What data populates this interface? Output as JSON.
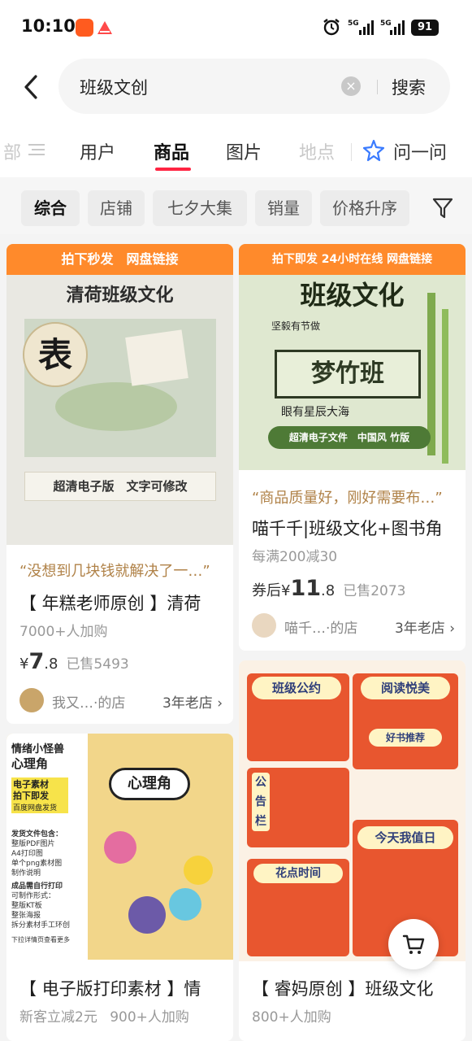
{
  "status_bar": {
    "time": "10:10",
    "signal1": "5G",
    "signal2": "5G",
    "battery": "91",
    "icons": [
      "app-icon",
      "app-icon",
      "alarm-icon",
      "signal-icon",
      "signal-icon",
      "battery-icon"
    ]
  },
  "search": {
    "query": "班级文创",
    "clear_icon": "close-icon",
    "submit_label": "搜索"
  },
  "tabs": [
    {
      "label": "部"
    },
    {
      "label": "用户"
    },
    {
      "label": "商品",
      "active": true
    },
    {
      "label": "图片"
    },
    {
      "label": "地点"
    },
    {
      "label": "问一问"
    }
  ],
  "filters": [
    {
      "label": "综合",
      "active": true
    },
    {
      "label": "店铺"
    },
    {
      "label": "七夕大集"
    },
    {
      "label": "销量"
    },
    {
      "label": "价格升序"
    }
  ],
  "products": [
    {
      "banner": "拍下秒发　网盘链接",
      "image_text_1": "清荷班级文化",
      "image_text_2": "表",
      "image_text_3": "超清电子版　文字可修改",
      "quote": "“没想到几块钱就解决了一…”",
      "title": "【 年糕老师原创 】清荷",
      "meta": "7000+人加购",
      "price_symbol": "¥",
      "price_int": "7",
      "price_dec": ".8",
      "sold": "已售5493",
      "shop_name": "我又…·的店",
      "shop_age": "3年老店"
    },
    {
      "banner": "拍下即发 24小时在线 网盘链接",
      "image_text_1": "班级文化",
      "image_text_2": "梦竹班",
      "image_text_3": "坚毅有节做",
      "image_text_4": "眼有星辰大海",
      "image_text_5": "超清电子文件　中国风 竹版",
      "quote": "“商品质量好，刚好需要布…”",
      "title": "喵千千|班级文化+图书角",
      "meta": "每满200减30",
      "price_prefix": "券后",
      "price_symbol": "¥",
      "price_int": "11",
      "price_dec": ".8",
      "sold": "已售2073",
      "shop_name": "喵千…·的店",
      "shop_age": "3年老店"
    },
    {
      "image_text_1": "情绪小怪兽",
      "image_text_2": "心理角",
      "image_text_3": "电子素材",
      "image_text_4": "拍下即发",
      "image_text_5": "百度网盘发货",
      "image_text_6": "发货文件包含：",
      "image_text_7": "整版PDF图片",
      "image_text_8": "A4打印图",
      "image_text_9": "单个png素材图",
      "image_text_10": "制作说明",
      "image_text_11": "成品需自行打印",
      "image_text_12": "可制作形式：",
      "image_text_13": "整版KT板",
      "image_text_14": "整张海报",
      "image_text_15": "拆分素材手工环创",
      "image_text_16": "下拉详情页查看更多",
      "image_text_17": "心理角",
      "title": "【 电子版打印素材 】情",
      "meta_a": "新客立减2元",
      "meta_b": "900+人加购"
    },
    {
      "image_text_1": "班级公约",
      "image_text_2": "阅读悦美",
      "image_text_3": "好书推荐",
      "image_text_4": "公",
      "image_text_5": "告",
      "image_text_6": "栏",
      "image_text_7": "花点时间",
      "image_text_8": "今天我值日",
      "title": "【 睿妈原创 】班级文化",
      "meta": "800+人加购"
    }
  ],
  "icons": {
    "back": "chevron-left-icon",
    "menu": "menu-icon",
    "ask": "star-icon",
    "filter": "filter-icon",
    "cart": "cart-icon",
    "shop_more": "chevron-right-icon"
  },
  "colors": {
    "accent": "#ff2442",
    "quote": "#b08248",
    "banner": "#ff8a2b",
    "banner_green": "#4e7a36"
  }
}
